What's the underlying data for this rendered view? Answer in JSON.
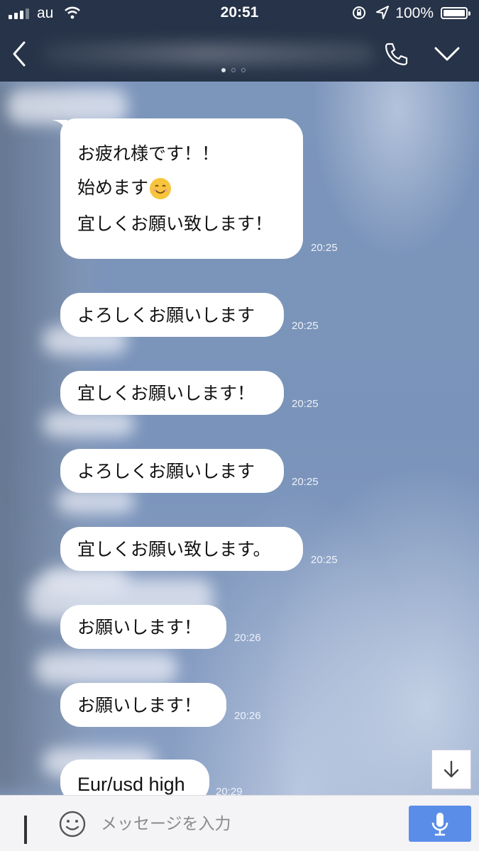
{
  "status_bar": {
    "carrier": "au",
    "time": "20:51",
    "battery": "100%"
  },
  "header": {
    "contact_name": "",
    "page_dots": 3,
    "active_dot": 0
  },
  "messages": [
    {
      "lines": [
        "お疲れ様です！！",
        "",
        "始めます",
        "",
        "宜しくお願い致します！"
      ],
      "time": "20:25",
      "has_emoji": true
    },
    {
      "lines": [
        "よろしくお願いします"
      ],
      "time": "20:25"
    },
    {
      "lines": [
        "宜しくお願いします！"
      ],
      "time": "20:25"
    },
    {
      "lines": [
        "よろしくお願いします"
      ],
      "time": "20:25"
    },
    {
      "lines": [
        "宜しくお願い致します。"
      ],
      "time": "20:25"
    },
    {
      "lines": [
        "お願いします！"
      ],
      "time": "20:26"
    },
    {
      "lines": [
        "お願いします！"
      ],
      "time": "20:26"
    },
    {
      "lines": [
        "Eur/usd high"
      ],
      "time": "20:29"
    }
  ],
  "input": {
    "placeholder": "メッセージを入力"
  },
  "icons": {
    "back": "chevron-left-icon",
    "phone": "phone-icon",
    "menu": "chevron-down-icon",
    "scroll": "arrow-down-icon",
    "emoji": "smiley-icon",
    "mic": "microphone-icon"
  },
  "colors": {
    "header_bg": "#263348",
    "chat_bg": "#7f98bd",
    "bubble_bg": "#ffffff",
    "mic_button": "#5a8de8"
  }
}
